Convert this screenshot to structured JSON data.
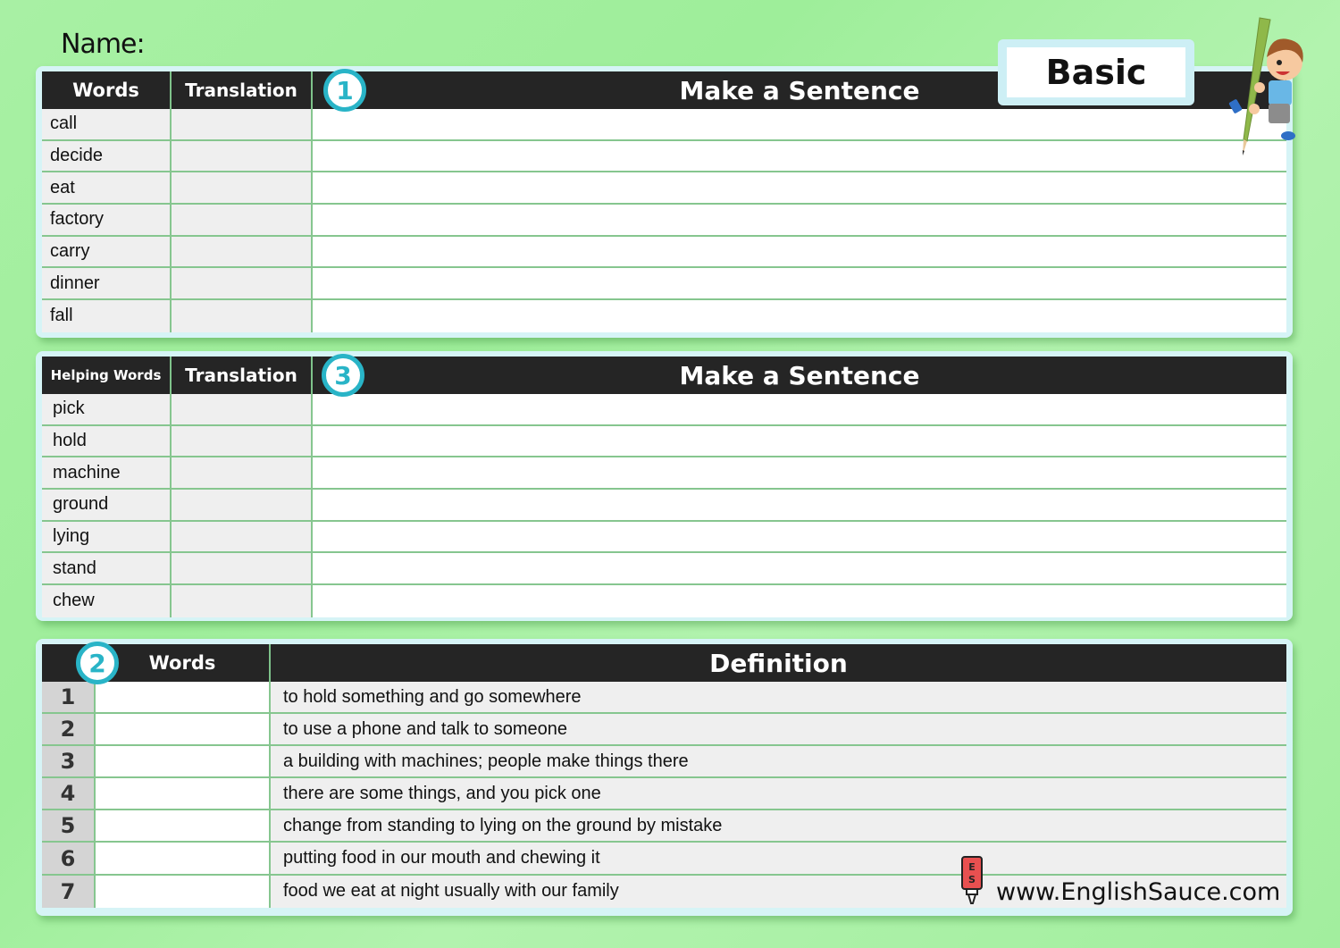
{
  "worksheet": {
    "name_label": "Name:",
    "level": "Basic",
    "brand": "www.EnglishSauce.com",
    "brand_logo_letters": "E S"
  },
  "section1": {
    "badge": "1",
    "headers": {
      "words": "Words",
      "translation": "Translation",
      "sentence": "Make a Sentence"
    },
    "words": [
      "call",
      "decide",
      "eat",
      "factory",
      "carry",
      "dinner",
      "fall"
    ]
  },
  "section3": {
    "badge": "3",
    "headers": {
      "words": "Helping Words",
      "translation": "Translation",
      "sentence": "Make a Sentence"
    },
    "words": [
      "pick",
      "hold",
      "machine",
      "ground",
      "lying",
      "stand",
      "chew"
    ]
  },
  "section2": {
    "badge": "2",
    "headers": {
      "words": "Words",
      "definition": "Definition"
    },
    "rows": [
      {
        "num": "1",
        "definition": "to hold something and go somewhere"
      },
      {
        "num": "2",
        "definition": "to use a phone and talk to someone"
      },
      {
        "num": "3",
        "definition": "a building with machines; people make things there"
      },
      {
        "num": "4",
        "definition": "there are some things, and you pick one"
      },
      {
        "num": "5",
        "definition": "change from standing to lying on the ground by mistake"
      },
      {
        "num": "6",
        "definition": "putting food in our mouth and chewing it"
      },
      {
        "num": "7",
        "definition": "food we eat at night usually with our family"
      }
    ]
  },
  "colors": {
    "background": "#a8f0a4",
    "header": "#252525",
    "badge": "#29b4c7",
    "grid": "#86c68f"
  }
}
